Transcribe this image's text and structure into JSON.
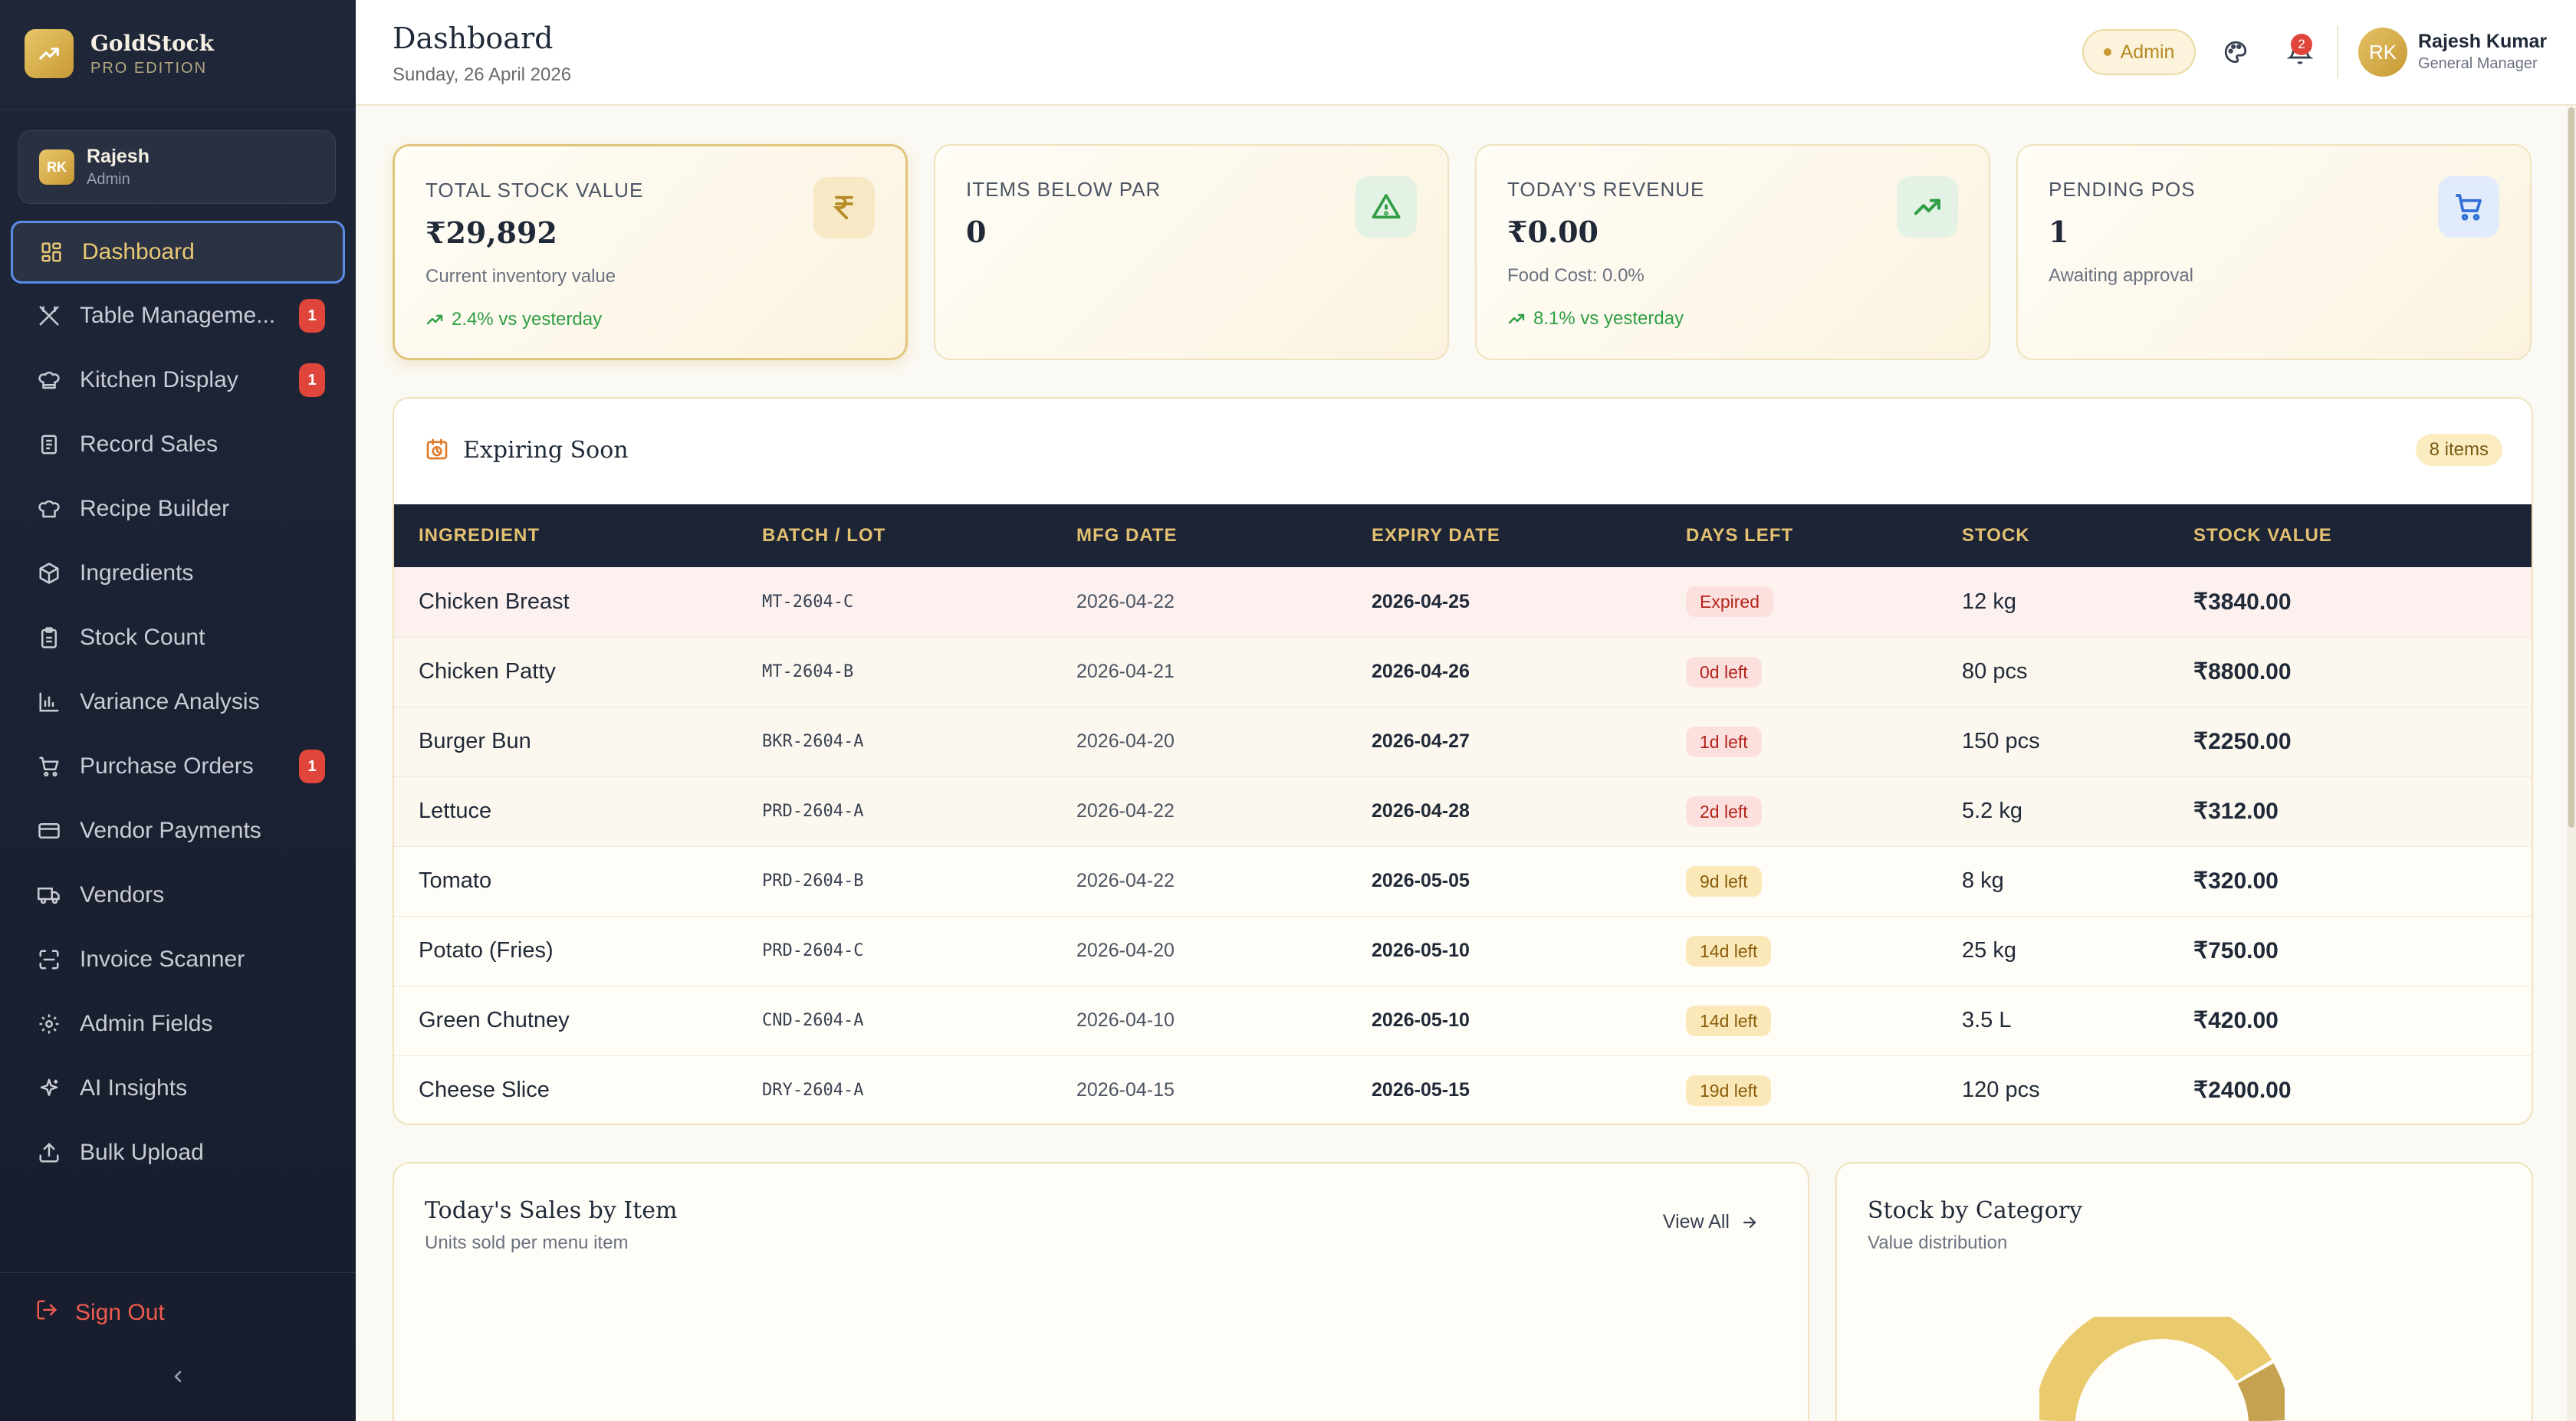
{
  "brand": {
    "name": "GoldStock",
    "edition": "PRO EDITION",
    "logo_icon": "trending-up-icon"
  },
  "sidebar_user": {
    "initials": "RK",
    "name": "Rajesh",
    "role": "Admin"
  },
  "nav": [
    {
      "label": "Dashboard",
      "icon": "grid-icon",
      "active": true
    },
    {
      "label": "Table Manageme...",
      "icon": "utensils-icon",
      "badge": "1"
    },
    {
      "label": "Kitchen Display",
      "icon": "chef-hat-icon",
      "badge": "1"
    },
    {
      "label": "Record Sales",
      "icon": "receipt-icon"
    },
    {
      "label": "Recipe Builder",
      "icon": "chef-hat-icon"
    },
    {
      "label": "Ingredients",
      "icon": "box-icon"
    },
    {
      "label": "Stock Count",
      "icon": "clipboard-icon"
    },
    {
      "label": "Variance Analysis",
      "icon": "bar-chart-icon"
    },
    {
      "label": "Purchase Orders",
      "icon": "cart-icon",
      "badge": "1"
    },
    {
      "label": "Vendor Payments",
      "icon": "credit-card-icon"
    },
    {
      "label": "Vendors",
      "icon": "truck-icon"
    },
    {
      "label": "Invoice Scanner",
      "icon": "scan-icon"
    },
    {
      "label": "Admin Fields",
      "icon": "gear-icon"
    },
    {
      "label": "AI Insights",
      "icon": "sparkles-icon"
    },
    {
      "label": "Bulk Upload",
      "icon": "upload-icon"
    }
  ],
  "sign_out": "Sign Out",
  "header": {
    "title": "Dashboard",
    "date": "Sunday, 26 April 2026",
    "role_pill": "Admin",
    "notifications": "2",
    "user_initials": "RK",
    "user_name": "Rajesh Kumar",
    "user_role": "General Manager"
  },
  "stats": [
    {
      "label": "TOTAL STOCK VALUE",
      "value": "₹29,892",
      "sub": "Current inventory value",
      "trend": "2.4% vs yesterday",
      "icon": "rupee-icon"
    },
    {
      "label": "ITEMS BELOW PAR",
      "value": "0",
      "icon": "alert-triangle-icon"
    },
    {
      "label": "TODAY'S REVENUE",
      "value": "₹0.00",
      "sub": "Food Cost: 0.0%",
      "trend": "8.1% vs yesterday",
      "icon": "trending-up-icon"
    },
    {
      "label": "PENDING POS",
      "value": "1",
      "sub": "Awaiting approval",
      "icon": "cart-icon"
    }
  ],
  "expiring": {
    "title": "Expiring Soon",
    "count": "8 items",
    "columns": [
      "INGREDIENT",
      "BATCH / LOT",
      "MFG DATE",
      "EXPIRY DATE",
      "DAYS LEFT",
      "STOCK",
      "STOCK VALUE"
    ],
    "rows": [
      {
        "ingredient": "Chicken Breast",
        "batch": "MT-2604-C",
        "mfg": "2026-04-22",
        "expiry": "2026-04-25",
        "days": "Expired",
        "stock": "12 kg",
        "value": "₹3840.00"
      },
      {
        "ingredient": "Chicken Patty",
        "batch": "MT-2604-B",
        "mfg": "2026-04-21",
        "expiry": "2026-04-26",
        "days": "0d left",
        "stock": "80 pcs",
        "value": "₹8800.00"
      },
      {
        "ingredient": "Burger Bun",
        "batch": "BKR-2604-A",
        "mfg": "2026-04-20",
        "expiry": "2026-04-27",
        "days": "1d left",
        "stock": "150 pcs",
        "value": "₹2250.00"
      },
      {
        "ingredient": "Lettuce",
        "batch": "PRD-2604-A",
        "mfg": "2026-04-22",
        "expiry": "2026-04-28",
        "days": "2d left",
        "stock": "5.2 kg",
        "value": "₹312.00"
      },
      {
        "ingredient": "Tomato",
        "batch": "PRD-2604-B",
        "mfg": "2026-04-22",
        "expiry": "2026-05-05",
        "days": "9d left",
        "stock": "8 kg",
        "value": "₹320.00"
      },
      {
        "ingredient": "Potato (Fries)",
        "batch": "PRD-2604-C",
        "mfg": "2026-04-20",
        "expiry": "2026-05-10",
        "days": "14d left",
        "stock": "25 kg",
        "value": "₹750.00"
      },
      {
        "ingredient": "Green Chutney",
        "batch": "CND-2604-A",
        "mfg": "2026-04-10",
        "expiry": "2026-05-10",
        "days": "14d left",
        "stock": "3.5 L",
        "value": "₹420.00"
      },
      {
        "ingredient": "Cheese Slice",
        "batch": "DRY-2604-A",
        "mfg": "2026-04-15",
        "expiry": "2026-05-15",
        "days": "19d left",
        "stock": "120 pcs",
        "value": "₹2400.00"
      }
    ]
  },
  "sales_card": {
    "title": "Today's Sales by Item",
    "subtitle": "Units sold per menu item",
    "view_all": "View All"
  },
  "category_card": {
    "title": "Stock by Category",
    "subtitle": "Value distribution"
  },
  "colors": {
    "accent": "#c89a34",
    "sidebar": "#1e2638",
    "danger": "#e0453b",
    "success": "#2f9e44"
  }
}
